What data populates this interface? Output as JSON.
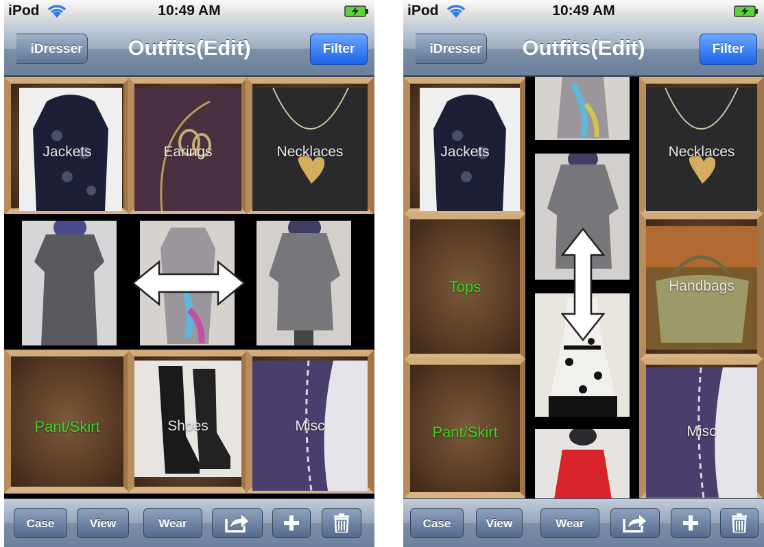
{
  "screens": [
    {
      "status": {
        "carrier": "iPod",
        "time": "10:49 AM"
      },
      "nav": {
        "back_label": "iDresser",
        "title": "Outfits(Edit)",
        "filter_label": "Filter"
      },
      "cells": [
        {
          "label": "Jackets"
        },
        {
          "label": "Earings"
        },
        {
          "label": "Necklaces"
        },
        {
          "label": ""
        },
        {
          "label": ""
        },
        {
          "label": ""
        },
        {
          "label": "Pant/Skirt"
        },
        {
          "label": "Shoes"
        },
        {
          "label": "Misc"
        }
      ],
      "toolbar": {
        "case": "Case",
        "view": "View",
        "wear": "Wear"
      }
    },
    {
      "status": {
        "carrier": "iPod",
        "time": "10:49 AM"
      },
      "nav": {
        "back_label": "iDresser",
        "title": "Outfits(Edit)",
        "filter_label": "Filter"
      },
      "cells": [
        {
          "label": "Jackets"
        },
        {
          "label": "Necklaces"
        },
        {
          "label": "Tops"
        },
        {
          "label": "Handbags"
        },
        {
          "label": "Pant/Skirt"
        },
        {
          "label": "Misc"
        }
      ],
      "toolbar": {
        "case": "Case",
        "view": "View",
        "wear": "Wear"
      }
    }
  ],
  "icons": {
    "wifi": "wifi-icon",
    "battery": "battery-charging-icon",
    "share": "share-icon",
    "add": "plus-icon",
    "delete": "trash-icon",
    "swipe_h": "horizontal-double-arrow-icon",
    "swipe_v": "vertical-double-arrow-icon"
  },
  "colors": {
    "empty_label": "#37d624",
    "nav_button": "#1a63e8"
  }
}
